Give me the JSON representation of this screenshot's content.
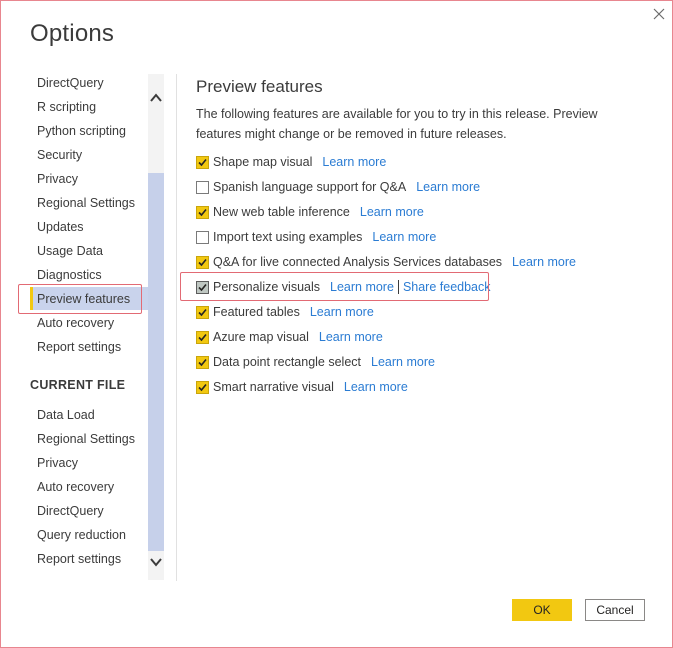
{
  "dialog": {
    "title": "Options",
    "close_icon": "close-icon"
  },
  "nav": {
    "global_items": [
      {
        "label": "DirectQuery"
      },
      {
        "label": "R scripting"
      },
      {
        "label": "Python scripting"
      },
      {
        "label": "Security"
      },
      {
        "label": "Privacy"
      },
      {
        "label": "Regional Settings"
      },
      {
        "label": "Updates"
      },
      {
        "label": "Usage Data"
      },
      {
        "label": "Diagnostics"
      },
      {
        "label": "Preview features"
      },
      {
        "label": "Auto recovery"
      },
      {
        "label": "Report settings"
      }
    ],
    "selected": "Preview features",
    "current_file_heading": "CURRENT FILE",
    "current_file_items": [
      {
        "label": "Data Load"
      },
      {
        "label": "Regional Settings"
      },
      {
        "label": "Privacy"
      },
      {
        "label": "Auto recovery"
      },
      {
        "label": "DirectQuery"
      },
      {
        "label": "Query reduction"
      },
      {
        "label": "Report settings"
      }
    ]
  },
  "content": {
    "title": "Preview features",
    "description": "The following features are available for you to try in this release. Preview features might change or be removed in future releases.",
    "features": [
      {
        "label": "Shape map visual",
        "checked": true,
        "link": "Learn more"
      },
      {
        "label": "Spanish language support for Q&A",
        "checked": false,
        "link": "Learn more"
      },
      {
        "label": "New web table inference",
        "checked": true,
        "link": "Learn more"
      },
      {
        "label": "Import text using examples",
        "checked": false,
        "link": "Learn more"
      },
      {
        "label": "Q&A for live connected Analysis Services databases",
        "checked": true,
        "link": "Learn more"
      },
      {
        "label": "Personalize visuals",
        "checked": true,
        "link": "Learn more",
        "extra_link": "Share feedback"
      },
      {
        "label": "Featured tables",
        "checked": true,
        "link": "Learn more"
      },
      {
        "label": "Azure map visual",
        "checked": true,
        "link": "Learn more"
      },
      {
        "label": "Data point rectangle select",
        "checked": true,
        "link": "Learn more"
      },
      {
        "label": "Smart narrative visual",
        "checked": true,
        "link": "Learn more"
      }
    ]
  },
  "buttons": {
    "ok": "OK",
    "cancel": "Cancel"
  },
  "colors": {
    "accent": "#f2c811",
    "link": "#2b7cd3",
    "highlight_border": "#e26a74",
    "selected_bg": "#c9d3ec"
  }
}
